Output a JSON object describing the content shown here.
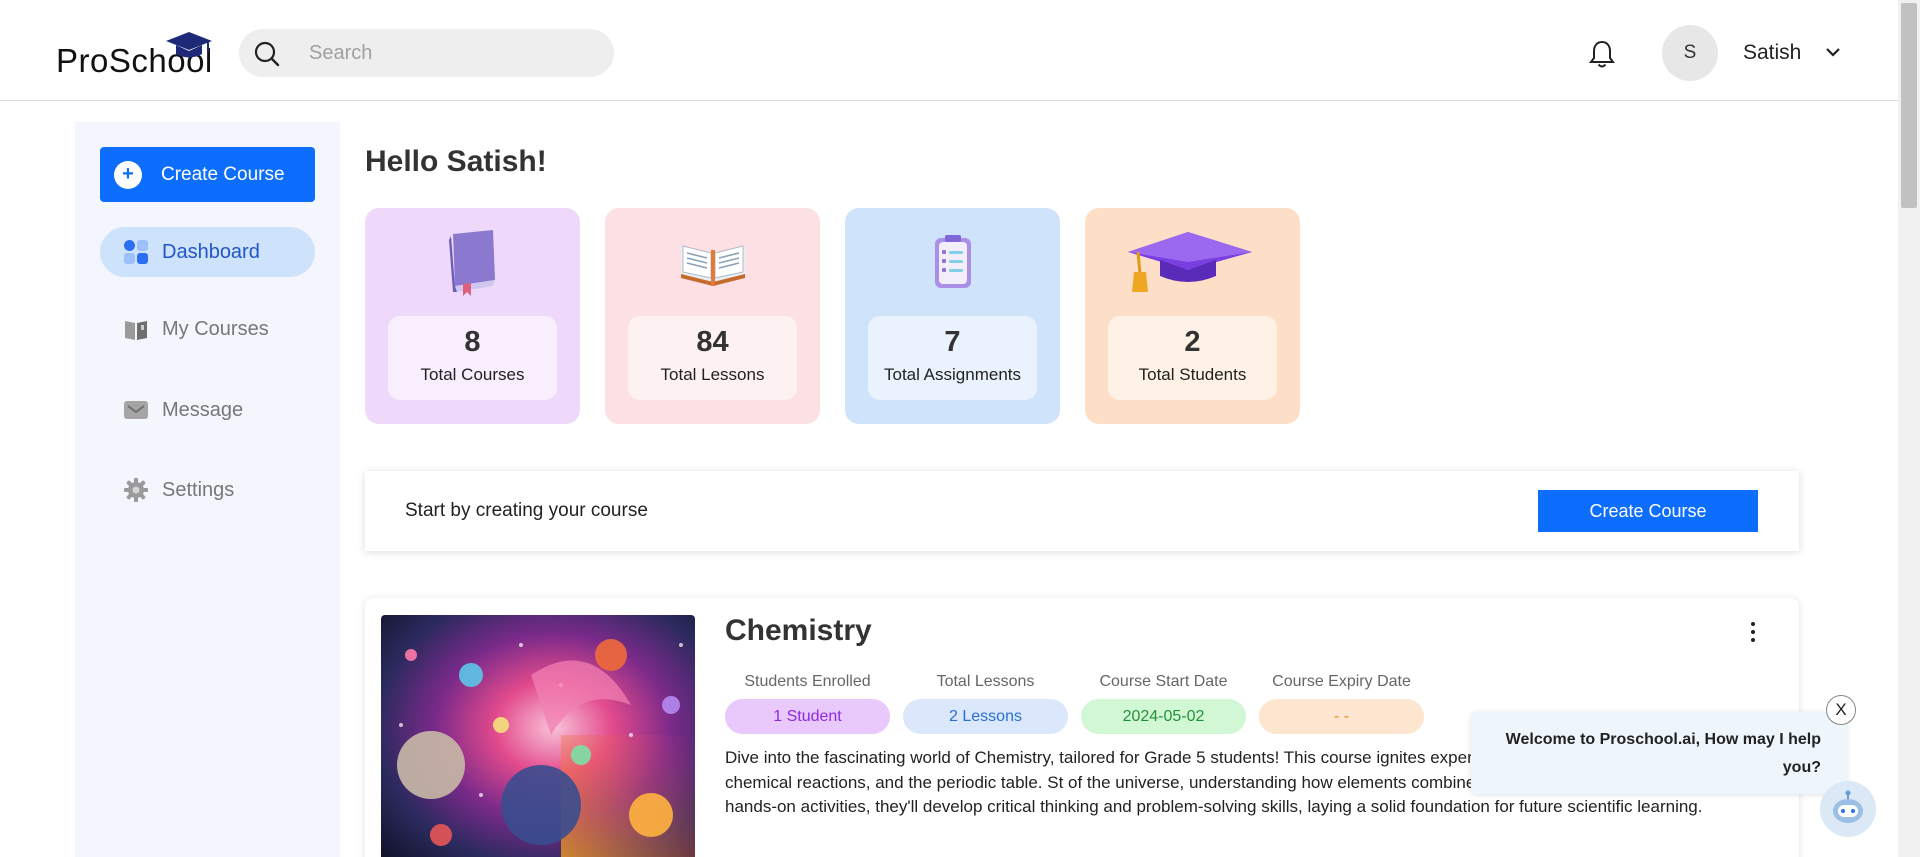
{
  "header": {
    "logo_text": "ProSchool",
    "search_placeholder": "Search",
    "avatar_initial": "S",
    "user_name": "Satish"
  },
  "sidebar": {
    "create_label": "Create Course",
    "items": [
      {
        "label": "Dashboard",
        "icon": "grid-icon",
        "active": true
      },
      {
        "label": "My Courses",
        "icon": "book-icon",
        "active": false
      },
      {
        "label": "Message",
        "icon": "mail-icon",
        "active": false
      },
      {
        "label": "Settings",
        "icon": "gear-icon",
        "active": false
      }
    ]
  },
  "main": {
    "greeting": "Hello Satish!",
    "stats": [
      {
        "value": "8",
        "label": "Total Courses",
        "color": "#efd9fb",
        "icon": "book-icon"
      },
      {
        "value": "84",
        "label": "Total Lessons",
        "color": "#fde0e3",
        "icon": "open-book-icon"
      },
      {
        "value": "7",
        "label": "Total Assignments",
        "color": "#cfe3fa",
        "icon": "clipboard-icon"
      },
      {
        "value": "2",
        "label": "Total Students",
        "color": "#fddfc8",
        "icon": "graduation-cap-icon"
      }
    ],
    "start_text": "Start by creating your course",
    "start_button": "Create Course"
  },
  "course": {
    "title": "Chemistry",
    "meta": [
      {
        "heading": "Students Enrolled",
        "value": "1  Student",
        "bg": "#e9c8fb",
        "fg": "#8a2be2"
      },
      {
        "heading": "Total Lessons",
        "value": "2  Lessons",
        "bg": "#dbe8fb",
        "fg": "#2b6ed6"
      },
      {
        "heading": "Course Start Date",
        "value": "2024-05-02",
        "bg": "#d2f7d4",
        "fg": "#23913a"
      },
      {
        "heading": "Course Expiry Date",
        "value": "- -",
        "bg": "#fde6cf",
        "fg": "#e58a1f"
      }
    ],
    "description": "Dive into the fascinating world of Chemistry, tailored for Grade 5 students! This course ignites experiments and engaging lessons on matter, chemical reactions, and the periodic table. St of the universe, understanding how elements combine and interact in everyday life. Through hands-on activities, they'll develop critical thinking and problem-solving skills, laying a solid foundation for future scientific learning."
  },
  "chat": {
    "message": "Welcome to Proschool.ai, How may I help you?",
    "close": "X"
  }
}
